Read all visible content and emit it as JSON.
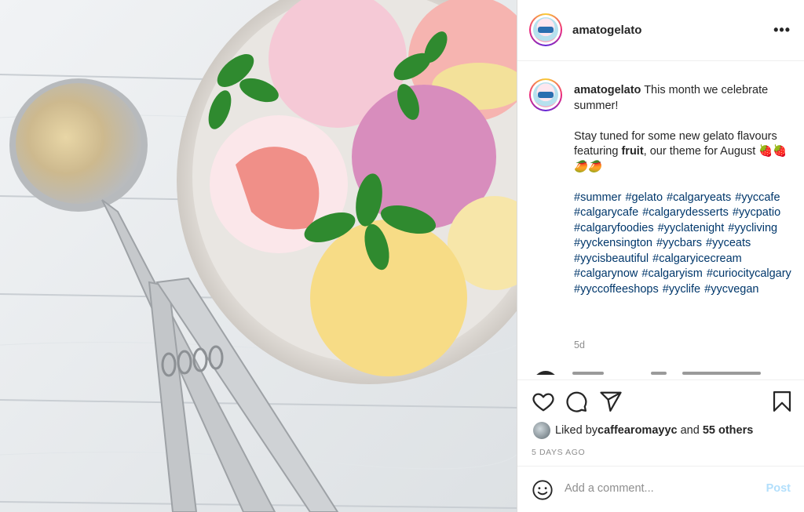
{
  "post": {
    "username": "amatogelato",
    "more_icon": "more-horizontal-icon",
    "more_label": "•••",
    "caption": {
      "username": "amatogelato",
      "line1": "This month we celebrate summer!",
      "line2_pre": "Stay tuned for some new gelato flavours featuring ",
      "line2_bold": "fruit",
      "line2_post": ", our theme for August",
      "emojis": "🍓🍓🥭🥭",
      "hashtags": "#summer #gelato #calgaryeats #yyccafe #calgarycafe #calgarydesserts #yycpatio #calgaryfoodies #yyclatenight #yycliving #yyckensington #yycbars #yyceats #yycisbeautiful #calgaryicecream #calgarynow #calgaryism #curiocitycalgary #yyccoffeeshops #yyclife #yycvegan",
      "time_ago": "5d"
    },
    "actions": {
      "like_icon": "heart-icon",
      "comment_icon": "comment-icon",
      "share_icon": "paper-plane-icon",
      "save_icon": "bookmark-icon"
    },
    "likes": {
      "prefix": "Liked by ",
      "user": "caffearomayyc",
      "middle": " and ",
      "others": "55 others"
    },
    "date": "5 DAYS AGO",
    "comment_box": {
      "emoji_icon": "smiley-icon",
      "placeholder": "Add a comment...",
      "post_label": "Post"
    }
  },
  "colors": {
    "link": "#00376b",
    "muted": "#8e8e8e",
    "post_disabled": "#b2dffc"
  }
}
